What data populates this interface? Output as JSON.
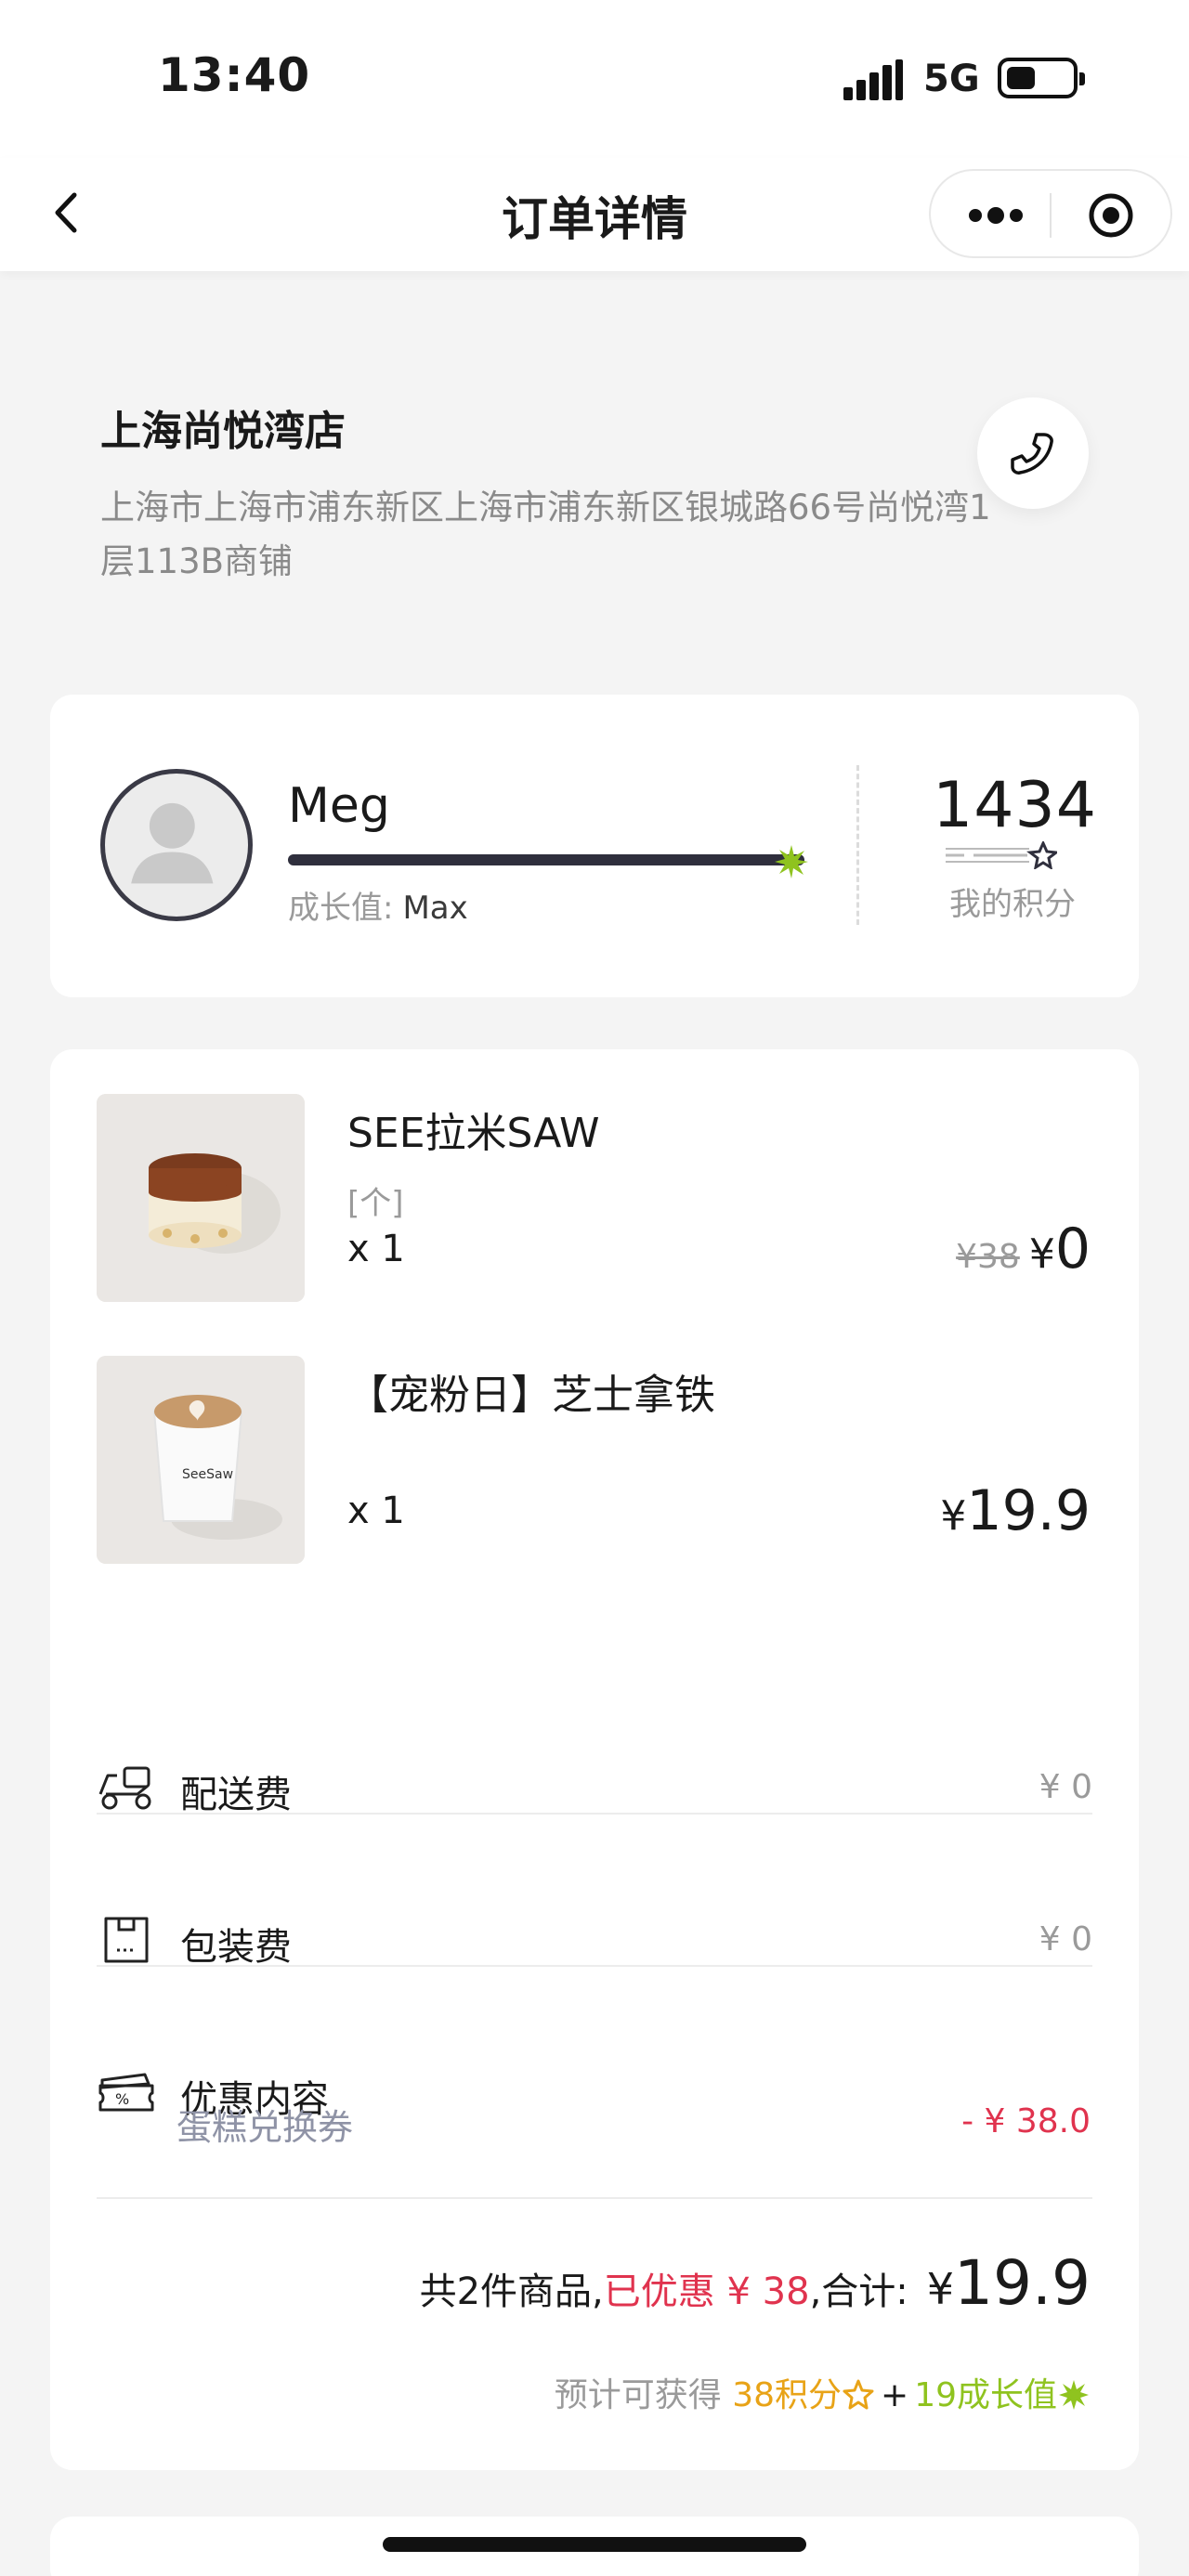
{
  "status_bar": {
    "time": "13:40",
    "network": "5G"
  },
  "nav": {
    "title": "订单详情"
  },
  "store": {
    "name": "上海尚悦湾店",
    "address": "上海市上海市浦东新区上海市浦东新区银城路66号尚悦湾1层113B商铺"
  },
  "member": {
    "name": "Meg",
    "growth_label": "成长值:",
    "growth_value": "Max",
    "growth_progress": 1.0,
    "points": "1434",
    "points_label": "我的积分"
  },
  "products": [
    {
      "name": "SEE拉米SAW",
      "spec": "[个]",
      "qty": "x 1",
      "original_price": "¥38",
      "currency": "¥",
      "price": "0"
    },
    {
      "name": "【宠粉日】芝士拿铁",
      "spec": "",
      "qty": "x 1",
      "original_price": "",
      "currency": "¥",
      "price": "19.9"
    }
  ],
  "fees": {
    "delivery": {
      "label": "配送费",
      "value": "¥ 0"
    },
    "packaging": {
      "label": "包装费",
      "value": "¥ 0"
    },
    "discount": {
      "label": "优惠内容",
      "item": "蛋糕兑换券",
      "value": "- ¥ 38.0"
    }
  },
  "summary": {
    "count_text": "共2件商品,",
    "saved_text": "已优惠 ¥ 38",
    "total_label": ",合计:",
    "currency": "¥",
    "total": "19.9"
  },
  "earn": {
    "prefix": "预计可获得",
    "points": "38积分",
    "plus": "+",
    "growth": "19成长值"
  },
  "colors": {
    "accent_red": "#e0334e",
    "gold": "#e8a317",
    "green": "#8fc31f",
    "dark": "#2f2f3d"
  }
}
